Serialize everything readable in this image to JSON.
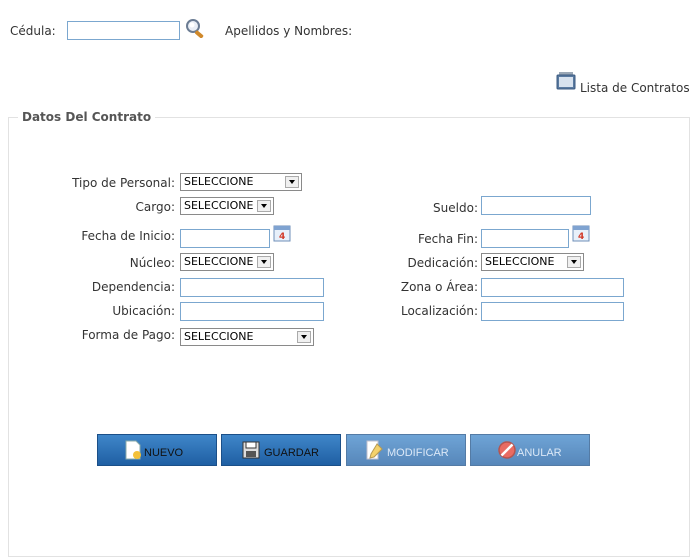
{
  "search": {
    "cedula_label": "Cédula:",
    "cedula_value": "",
    "nombres_label": "Apellidos y Nombres:"
  },
  "lista_contratos": "Lista de Contratos",
  "section_title": "Datos Del Contrato",
  "form": {
    "tipo_personal": {
      "label": "Tipo de Personal:",
      "value": "SELECCIONE"
    },
    "cargo": {
      "label": "Cargo:",
      "value": "SELECCIONE"
    },
    "sueldo": {
      "label": "Sueldo:",
      "value": ""
    },
    "fecha_inicio": {
      "label": "Fecha de Inicio:",
      "value": ""
    },
    "fecha_fin": {
      "label": "Fecha Fin:",
      "value": ""
    },
    "nucleo": {
      "label": "Núcleo:",
      "value": "SELECCIONE"
    },
    "dedicacion": {
      "label": "Dedicación:",
      "value": "SELECCIONE"
    },
    "dependencia": {
      "label": "Dependencia:",
      "value": ""
    },
    "zona_area": {
      "label": "Zona o Área:",
      "value": ""
    },
    "ubicacion": {
      "label": "Ubicación:",
      "value": ""
    },
    "localizacion": {
      "label": "Localización:",
      "value": ""
    },
    "forma_pago": {
      "label": "Forma de Pago:",
      "value": "SELECCIONE"
    }
  },
  "buttons": {
    "nuevo": "NUEVO",
    "guardar": "GUARDAR",
    "modificar": "MODIFICAR",
    "anular": "ANULAR"
  },
  "colors": {
    "button_blue": "#2a6fb5",
    "input_border": "#7ba7cf"
  }
}
